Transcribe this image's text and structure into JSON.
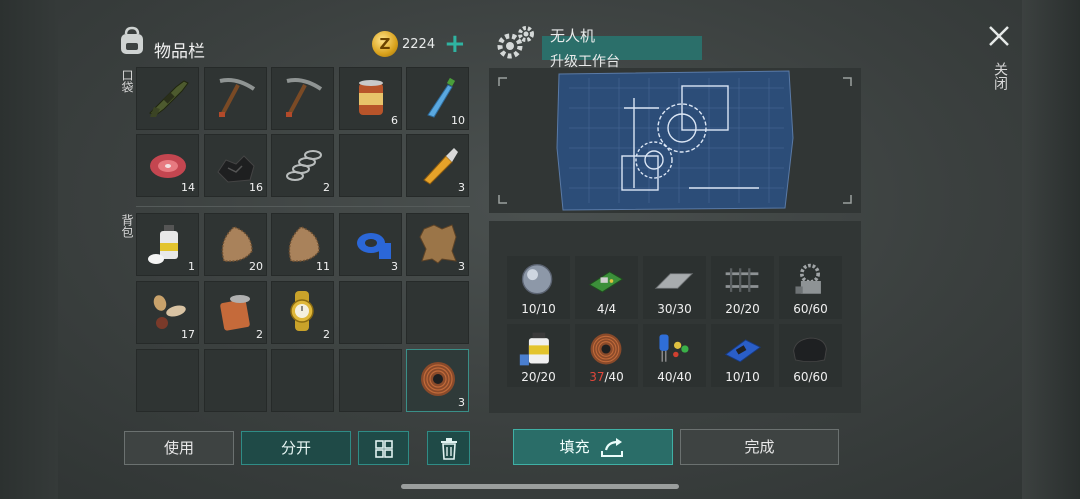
{
  "inventory": {
    "title": "物品栏",
    "coins": "2224",
    "coin_symbol": "Z",
    "pocket_label": "口袋",
    "backpack_label": "背包",
    "pocket_slots": [
      {
        "item": "rifle",
        "count": ""
      },
      {
        "item": "pickaxe",
        "count": ""
      },
      {
        "item": "pickaxe",
        "count": ""
      },
      {
        "item": "canned-food",
        "count": "6"
      },
      {
        "item": "water-bottle",
        "count": "10"
      },
      {
        "item": "raw-meat",
        "count": "14"
      },
      {
        "item": "coal",
        "count": "16"
      },
      {
        "item": "spring",
        "count": "2"
      },
      {
        "item": "empty",
        "count": ""
      },
      {
        "item": "glue",
        "count": "3"
      }
    ],
    "backpack_slots": [
      {
        "item": "spray-can",
        "count": "1"
      },
      {
        "item": "fur",
        "count": "20"
      },
      {
        "item": "fur",
        "count": "11"
      },
      {
        "item": "duct-tape",
        "count": "3"
      },
      {
        "item": "leather",
        "count": "3"
      },
      {
        "item": "seeds",
        "count": "17"
      },
      {
        "item": "open-can",
        "count": "2"
      },
      {
        "item": "wristwatch",
        "count": "2"
      },
      {
        "item": "empty",
        "count": ""
      },
      {
        "item": "empty",
        "count": ""
      },
      {
        "item": "empty",
        "count": ""
      },
      {
        "item": "empty",
        "count": ""
      },
      {
        "item": "empty",
        "count": ""
      },
      {
        "item": "empty",
        "count": ""
      },
      {
        "item": "copper-wire",
        "count": "3"
      }
    ],
    "buttons": {
      "use": "使用",
      "split": "分开"
    }
  },
  "workbench": {
    "name": "无人机",
    "subtitle": "升级工作台",
    "requirements": [
      {
        "item": "lens",
        "have": "10",
        "need": "/10",
        "ok": true
      },
      {
        "item": "circuit-board",
        "have": "4",
        "need": "/4",
        "ok": true
      },
      {
        "item": "metal-plate",
        "have": "30",
        "need": "/30",
        "ok": true
      },
      {
        "item": "rails",
        "have": "20",
        "need": "/20",
        "ok": true
      },
      {
        "item": "mechanism",
        "have": "60",
        "need": "/60",
        "ok": true
      },
      {
        "item": "resin",
        "have": "20",
        "need": "/20",
        "ok": true
      },
      {
        "item": "copper-wire",
        "have": "37",
        "need": "/40",
        "ok": false
      },
      {
        "item": "capacitors",
        "have": "40",
        "need": "/40",
        "ok": true
      },
      {
        "item": "chip",
        "have": "10",
        "need": "/10",
        "ok": true
      },
      {
        "item": "rubber",
        "have": "60",
        "need": "/60",
        "ok": true
      }
    ],
    "buttons": {
      "fill": "填充",
      "done": "完成"
    }
  },
  "close": {
    "label": "关闭"
  },
  "colors": {
    "accent": "#2fb3a1",
    "missing": "#e0473b"
  }
}
